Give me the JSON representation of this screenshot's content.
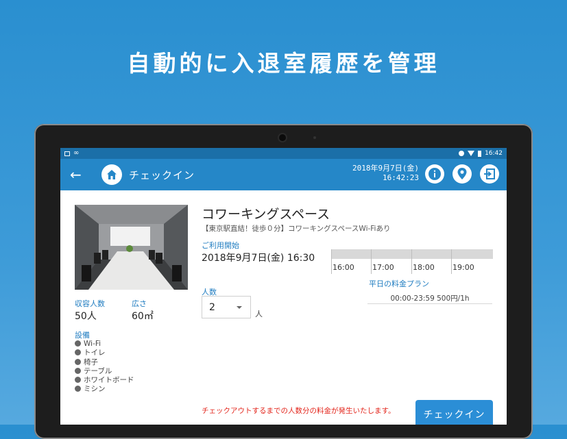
{
  "headline": "自動的に入退室履歴を管理",
  "statusbar": {
    "infinity": "∞",
    "time": "16:42"
  },
  "appbar": {
    "back_glyph": "←",
    "title": "チェックイン",
    "date": "2018年9月7日(金)",
    "time": "16:42:23"
  },
  "room": {
    "capacity_label": "収容人数",
    "capacity_value": "50人",
    "area_label": "広さ",
    "area_value": "60㎡",
    "equipment_label": "設備",
    "equipment": [
      "Wi-Fi",
      "トイレ",
      "椅子",
      "テーブル",
      "ホワイトボード",
      "ミシン"
    ]
  },
  "space": {
    "name": "コワーキングスペース",
    "description": "【東京駅直結！徒歩０分】コワーキングスペースWi-Fiあり"
  },
  "usage": {
    "start_label": "ご利用開始",
    "start_value": "2018年9月7日(金) 16:30",
    "timeline_labels": [
      "16:00",
      "17:00",
      "18:00",
      "19:00"
    ]
  },
  "plan": {
    "label": "平日の料金プラン",
    "row": "00:00-23:59  500円/1h"
  },
  "people": {
    "label": "人数",
    "value": "2",
    "unit": "人"
  },
  "notice": "チェックアウトするまでの人数分の料金が発生いたします。",
  "checkin_button": "チェックイン",
  "colors": {
    "appbar": "#2587c8",
    "statusbar": "#1b6fa8",
    "accent_label": "#1f7cc0",
    "notice_red": "#e3261c",
    "button": "#2b8ed6"
  },
  "icons": [
    "home-icon",
    "info-icon",
    "location-pin-icon",
    "exit-icon",
    "back-arrow-icon"
  ]
}
